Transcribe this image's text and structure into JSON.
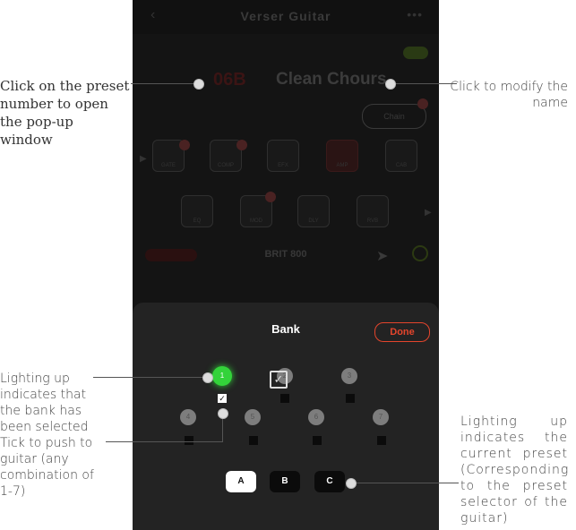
{
  "phone": {
    "app_title": "Verser Guitar",
    "back_icon": "back-arrow-icon",
    "more_icon": "more-icon",
    "preset_number": "06B",
    "preset_name": "Clean Chours",
    "chain_button": "Chain",
    "modules_row1": [
      "GATE",
      "COMP",
      "EFX",
      "AMP",
      "CAB"
    ],
    "modules_row2": [
      "EQ",
      "MOD",
      "DLY",
      "RVB"
    ],
    "amp_model": "BRIT 800",
    "bank_panel": {
      "title": "Bank",
      "done_label": "Done",
      "banks": [
        "1",
        "2",
        "3",
        "4",
        "5",
        "6",
        "7"
      ],
      "selected_bank": "1",
      "presets": [
        "A",
        "B",
        "C"
      ],
      "selected_preset": "A"
    }
  },
  "annotations": {
    "preset_number": "Click on the preset number to open the pop-up window",
    "name": "Click to modify the name",
    "bank_lit": "Lighting up indicates that the bank has been selected",
    "tick_push": "Tick to push to guitar (any combination of 1-7)",
    "preset_lit": "Lighting up indicates the current preset (Corresponding to the preset selector of the guitar)"
  }
}
